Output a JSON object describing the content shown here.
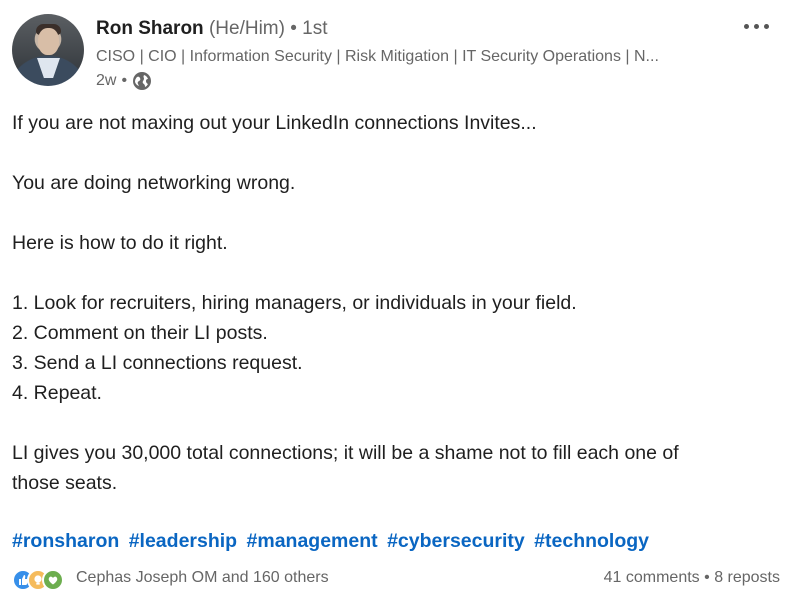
{
  "post": {
    "author": {
      "name": "Ron Sharon",
      "pronouns": "(He/Him)",
      "separator": "•",
      "degree": "1st",
      "headline": "CISO | CIO | Information Security | Risk Mitigation | IT Security Operations | N...",
      "time": "2w",
      "visibility_icon": "globe-icon"
    },
    "menu_icon": "more-options-icon",
    "body": {
      "line1": "If you are not maxing out your LinkedIn connections Invites...",
      "line2": "You are doing networking wrong.",
      "line3": "Here is how to do it right.",
      "steps": [
        "1. Look for recruiters, hiring managers, or individuals in your field.",
        "2. Comment on their LI posts.",
        "3. Send a LI connections request.",
        "4. Repeat."
      ],
      "closing1": "LI gives you 30,000 total connections; it will be a shame not to fill each one of",
      "closing2": "those seats."
    },
    "hashtags": [
      "#ronsharon",
      "#leadership",
      "#management",
      "#cybersecurity",
      "#technology"
    ],
    "social": {
      "reaction_icons": [
        "like-icon",
        "insightful-icon",
        "support-icon"
      ],
      "reactors": "Cephas Joseph OM and 160 others",
      "comments": "41 comments",
      "dot": "•",
      "reposts": "8 reposts"
    }
  }
}
